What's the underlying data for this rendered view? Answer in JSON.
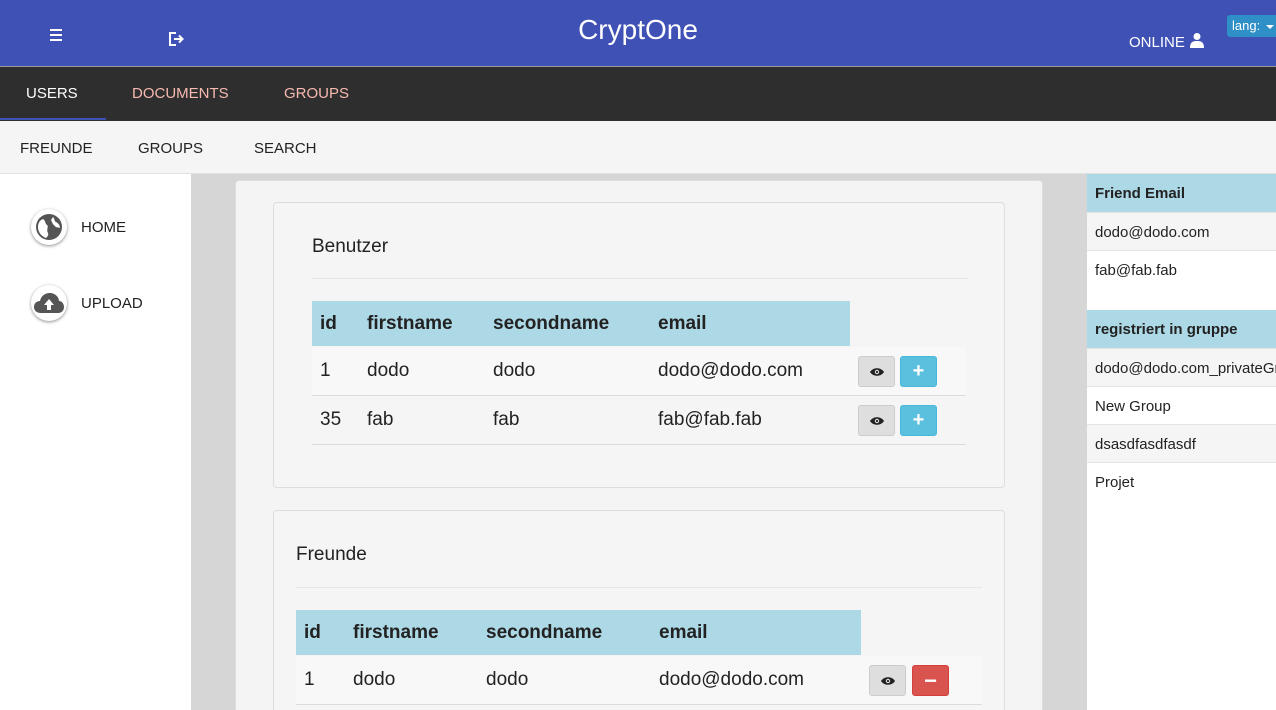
{
  "header": {
    "title": "CryptOne",
    "status": "ONLINE",
    "lang_label": "lang:",
    "brand_color": "#3f51b5",
    "icons": {
      "menu": "hamburger-icon",
      "logout": "sign-out-icon",
      "user": "user-icon",
      "lang": "caret-down-icon"
    }
  },
  "main_nav": {
    "tabs": [
      {
        "label": "USERS"
      },
      {
        "label": "DOCUMENTS"
      },
      {
        "label": "GROUPS"
      }
    ]
  },
  "sub_nav": {
    "items": [
      {
        "label": "FREUNDE"
      },
      {
        "label": "GROUPS"
      },
      {
        "label": "SEARCH"
      }
    ]
  },
  "sidebar": {
    "items": [
      {
        "label": "HOME",
        "icon": "globe-icon"
      },
      {
        "label": "UPLOAD",
        "icon": "cloud-upload-icon"
      }
    ]
  },
  "benutzer": {
    "title": "Benutzer",
    "columns": [
      "id",
      "firstname",
      "secondname",
      "email"
    ],
    "rows": [
      {
        "id": "1",
        "firstname": "dodo",
        "secondname": "dodo",
        "email": "dodo@dodo.com"
      },
      {
        "id": "35",
        "firstname": "fab",
        "secondname": "fab",
        "email": "fab@fab.fab"
      }
    ],
    "add_symbol": "+"
  },
  "freunde": {
    "title": "Freunde",
    "columns": [
      "id",
      "firstname",
      "secondname",
      "email"
    ],
    "rows": [
      {
        "id": "1",
        "firstname": "dodo",
        "secondname": "dodo",
        "email": "dodo@dodo.com"
      }
    ],
    "remove_symbol": "−"
  },
  "rightbar": {
    "friend_email_header": "Friend Email",
    "friend_emails": [
      "dodo@dodo.com",
      "fab@fab.fab"
    ],
    "groups_header": "registriert in gruppe",
    "groups": [
      "dodo@dodo.com_privateGroup",
      "New Group",
      "dsasdfasdfasdf",
      "Projet"
    ]
  }
}
